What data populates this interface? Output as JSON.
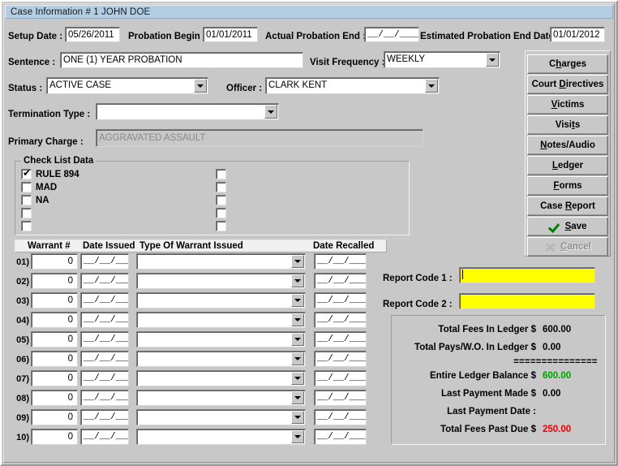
{
  "window": {
    "title": "Case Information # 1 JOHN DOE"
  },
  "header": {
    "setup_date_label": "Setup Date :",
    "setup_date_value": "05/26/2011",
    "probation_begin_label": "Probation Begin :",
    "probation_begin_value": "01/01/2011",
    "actual_probation_end_label": "Actual Probation End :",
    "actual_probation_end_value": "__/__/____",
    "estimated_probation_end_label": "Estimated Probation End Date :",
    "estimated_probation_end_value": "01/01/2012"
  },
  "form": {
    "sentence_label": "Sentence :",
    "sentence_value": "ONE (1) YEAR PROBATION",
    "visit_frequency_label": "Visit Frequency :",
    "visit_frequency_value": "WEEKLY",
    "status_label": "Status :",
    "status_value": "ACTIVE CASE",
    "officer_label": "Officer :",
    "officer_value": "CLARK KENT",
    "termination_type_label": "Termination Type :",
    "termination_type_value": "",
    "primary_charge_label": "Primary Charge :",
    "primary_charge_value": "AGGRAVATED ASSAULT"
  },
  "checklist": {
    "title": "Check List Data",
    "left_items": [
      {
        "label": "RULE 894",
        "checked": true,
        "tick": "✔"
      },
      {
        "label": "MAD",
        "checked": false,
        "tick": ""
      },
      {
        "label": "NA",
        "checked": false,
        "tick": ""
      },
      {
        "label": "",
        "checked": false,
        "tick": ""
      },
      {
        "label": "",
        "checked": false,
        "tick": ""
      }
    ],
    "right_items": [
      {
        "label": "",
        "checked": false,
        "tick": ""
      },
      {
        "label": "",
        "checked": false,
        "tick": ""
      },
      {
        "label": "",
        "checked": false,
        "tick": ""
      },
      {
        "label": "",
        "checked": false,
        "tick": ""
      },
      {
        "label": "",
        "checked": false,
        "tick": ""
      }
    ]
  },
  "warrants": {
    "columns": [
      "Warrant #",
      "Date Issued",
      "Type Of Warrant Issued",
      "Date Recalled"
    ],
    "rows": [
      {
        "num": "01)",
        "warrant_no": "0",
        "date_issued": "__/__/____",
        "type": "",
        "date_recalled": "__/__/____"
      },
      {
        "num": "02)",
        "warrant_no": "0",
        "date_issued": "__/__/____",
        "type": "",
        "date_recalled": "__/__/____"
      },
      {
        "num": "03)",
        "warrant_no": "0",
        "date_issued": "__/__/____",
        "type": "",
        "date_recalled": "__/__/____"
      },
      {
        "num": "04)",
        "warrant_no": "0",
        "date_issued": "__/__/____",
        "type": "",
        "date_recalled": "__/__/____"
      },
      {
        "num": "05)",
        "warrant_no": "0",
        "date_issued": "__/__/____",
        "type": "",
        "date_recalled": "__/__/____"
      },
      {
        "num": "06)",
        "warrant_no": "0",
        "date_issued": "__/__/____",
        "type": "",
        "date_recalled": "__/__/____"
      },
      {
        "num": "07)",
        "warrant_no": "0",
        "date_issued": "__/__/____",
        "type": "",
        "date_recalled": "__/__/____"
      },
      {
        "num": "08)",
        "warrant_no": "0",
        "date_issued": "__/__/____",
        "type": "",
        "date_recalled": "__/__/____"
      },
      {
        "num": "09)",
        "warrant_no": "0",
        "date_issued": "__/__/____",
        "type": "",
        "date_recalled": "__/__/____"
      },
      {
        "num": "10)",
        "warrant_no": "0",
        "date_issued": "__/__/____",
        "type": "",
        "date_recalled": "__/__/____"
      }
    ]
  },
  "report_codes": {
    "code1_label": "Report Code 1 :",
    "code1_value": "",
    "code2_label": "Report Code 2 :",
    "code2_value": "",
    "field_color": "#ffff00"
  },
  "ledger": {
    "rows": [
      {
        "label": "Total Fees In Ledger $",
        "value": "600.00",
        "color": ""
      },
      {
        "label": "Total Pays/W.O. In Ledger $",
        "value": "0.00",
        "color": ""
      },
      {
        "label": "Entire Ledger Balance $",
        "value": "600.00",
        "color": "green"
      },
      {
        "label": "Last Payment Made $",
        "value": "0.00",
        "color": ""
      },
      {
        "label": "Last Payment Date :",
        "value": "",
        "color": ""
      },
      {
        "label": "Total Fees Past Due $",
        "value": "250.00",
        "color": "red"
      }
    ],
    "separator": "===============",
    "green_hex": "#00a000",
    "red_hex": "#ee0000"
  },
  "buttons": [
    {
      "pre": "C",
      "key": "h",
      "post": "arges"
    },
    {
      "pre": "Court ",
      "key": "D",
      "post": "irectives"
    },
    {
      "pre": "",
      "key": "V",
      "post": "ictims"
    },
    {
      "pre": "Visi",
      "key": "t",
      "post": "s"
    },
    {
      "pre": "",
      "key": "N",
      "post": "otes/Audio"
    },
    {
      "pre": "",
      "key": "L",
      "post": "edger"
    },
    {
      "pre": "",
      "key": "F",
      "post": "orms"
    },
    {
      "pre": "Case ",
      "key": "R",
      "post": "eport"
    },
    {
      "pre": "",
      "key": "S",
      "post": "ave",
      "icon": "check-icon"
    },
    {
      "pre": "",
      "key": "C",
      "post": "ancel",
      "icon": "x-icon",
      "disabled": true
    }
  ]
}
